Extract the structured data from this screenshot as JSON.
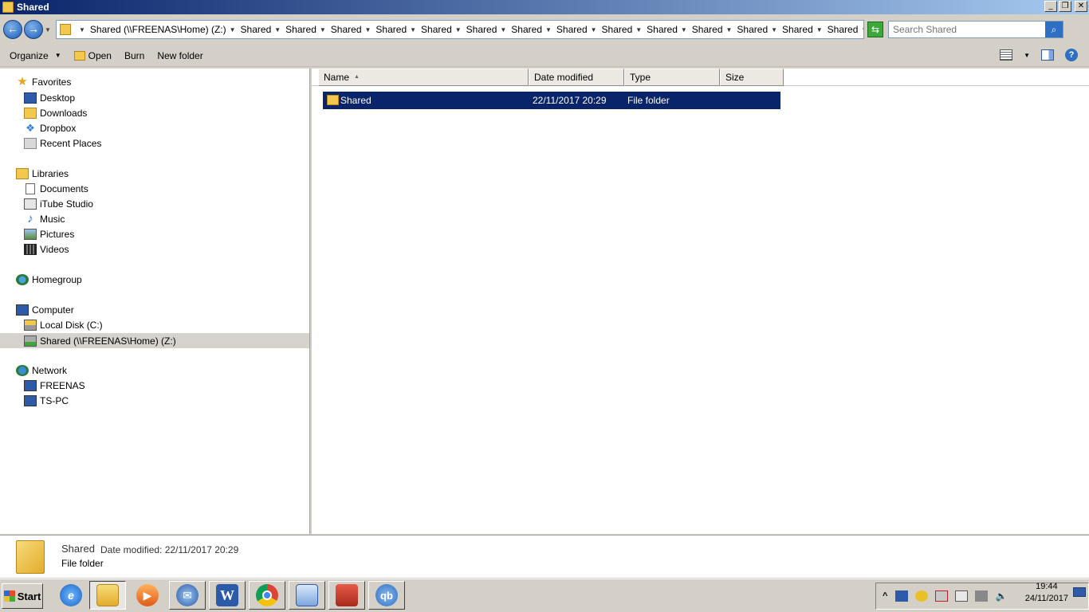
{
  "window": {
    "title": "Shared",
    "minimize_label": "_",
    "restore_label": "❐",
    "close_label": "✕"
  },
  "address": {
    "root": "Shared (\\\\FREENAS\\Home) (Z:)",
    "crumbs": [
      "Shared",
      "Shared",
      "Shared",
      "Shared",
      "Shared",
      "Shared",
      "Shared",
      "Shared",
      "Shared",
      "Shared",
      "Shared",
      "Shared",
      "Shared",
      "Shared"
    ]
  },
  "search": {
    "placeholder": "Search Shared"
  },
  "toolbar": {
    "organize": "Organize",
    "open": "Open",
    "burn": "Burn",
    "new_folder": "New folder"
  },
  "nav": {
    "favorites": {
      "label": "Favorites",
      "items": [
        "Desktop",
        "Downloads",
        "Dropbox",
        "Recent Places"
      ]
    },
    "libraries": {
      "label": "Libraries",
      "items": [
        "Documents",
        "iTube Studio",
        "Music",
        "Pictures",
        "Videos"
      ]
    },
    "homegroup": {
      "label": "Homegroup"
    },
    "computer": {
      "label": "Computer",
      "items": [
        "Local Disk (C:)",
        "Shared (\\\\FREENAS\\Home) (Z:)"
      ]
    },
    "network": {
      "label": "Network",
      "items": [
        "FREENAS",
        "TS-PC"
      ]
    }
  },
  "columns": {
    "name": "Name",
    "date_modified": "Date modified",
    "type": "Type",
    "size": "Size"
  },
  "files": [
    {
      "name": "Shared",
      "date_modified": "22/11/2017 20:29",
      "type": "File folder",
      "size": ""
    }
  ],
  "details": {
    "name": "Shared",
    "date_label": "Date modified:  22/11/2017 20:29",
    "type": "File folder"
  },
  "taskbar": {
    "start": "Start",
    "clock_time": "19:44",
    "clock_date": "24/11/2017",
    "apps": [
      "internet-explorer",
      "windows-explorer",
      "media-player",
      "thunderbird",
      "word",
      "chrome",
      "control-panel",
      "toolbox",
      "qbittorrent"
    ]
  },
  "colors": {
    "selection": "#0a246a",
    "title_start": "#0a246a",
    "title_end": "#a6caf0",
    "chrome": "#d4d0c8"
  }
}
